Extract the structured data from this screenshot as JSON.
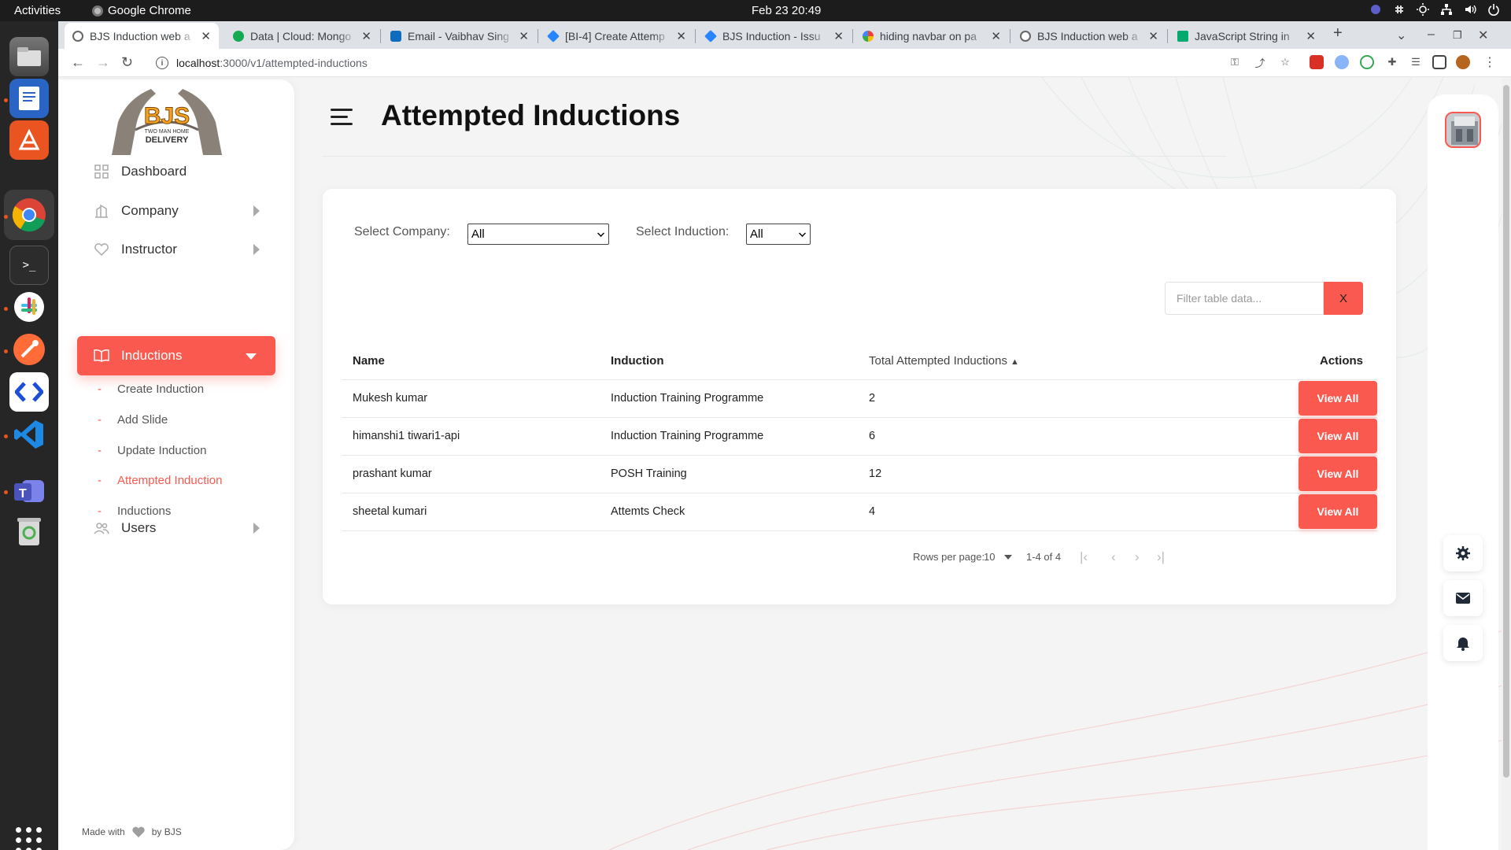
{
  "system": {
    "activities": "Activities",
    "app_name": "Google Chrome",
    "clock": "Feb 23  20:49"
  },
  "tabs": [
    {
      "title": "BJS Induction web a",
      "favicon": "globe-icon",
      "active": true
    },
    {
      "title": "Data | Cloud: Mongo",
      "favicon": "mongodb-icon"
    },
    {
      "title": "Email - Vaibhav Sing",
      "favicon": "outlook-icon"
    },
    {
      "title": "[BI-4] Create Attemp",
      "favicon": "jira-icon"
    },
    {
      "title": "BJS Induction - Issu",
      "favicon": "jira-icon"
    },
    {
      "title": "hiding navbar on pa",
      "favicon": "google-icon"
    },
    {
      "title": "BJS Induction web a",
      "favicon": "globe-icon"
    },
    {
      "title": "JavaScript String in",
      "favicon": "w3schools-icon"
    }
  ],
  "address": {
    "host": "localhost",
    "path": ":3000/v1/attempted-inductions"
  },
  "sidebar": {
    "logo_text": "BJS",
    "logo_sub1": "TWO MAN HOME",
    "logo_sub2": "DELIVERY",
    "items": [
      {
        "label": "Dashboard",
        "icon": "dashboard-icon"
      },
      {
        "label": "Company",
        "icon": "building-icon"
      },
      {
        "label": "Instructor",
        "icon": "heart-icon"
      },
      {
        "label": "Inductions",
        "icon": "book-icon",
        "active": true
      },
      {
        "label": "Users",
        "icon": "users-icon"
      }
    ],
    "sub_items": [
      {
        "label": "Create Induction"
      },
      {
        "label": "Add Slide"
      },
      {
        "label": "Update Induction"
      },
      {
        "label": "Attempted Induction",
        "active": true
      },
      {
        "label": "Inductions"
      }
    ],
    "footer_made": "Made with",
    "footer_by": "by BJS"
  },
  "header": {
    "title": "Attempted Inductions"
  },
  "filters": {
    "company_label": "Select Company:",
    "company_value": "All",
    "induction_label": "Select Induction:",
    "induction_value": "All",
    "search_placeholder": "Filter table data...",
    "clear_label": "X"
  },
  "table": {
    "columns": [
      "Name",
      "Induction",
      "Total Attempted Inductions",
      "Actions"
    ],
    "sort_indicator": "▲",
    "action_label": "View All",
    "rows": [
      {
        "name": "Mukesh kumar",
        "induction": "Induction Training Programme",
        "total": "2"
      },
      {
        "name": "himanshi1 tiwari1-api",
        "induction": "Induction Training Programme",
        "total": "6"
      },
      {
        "name": "prashant kumar",
        "induction": "POSH Training",
        "total": "12"
      },
      {
        "name": "sheetal kumari",
        "induction": "Attemts Check",
        "total": "4"
      }
    ]
  },
  "pagination": {
    "rows_label": "Rows per page:",
    "rows_value": "10",
    "range": "1-4 of 4"
  },
  "colors": {
    "accent": "#f9594f",
    "sidebar_bg": "#ffffff",
    "page_bg": "#f4f4f5"
  }
}
